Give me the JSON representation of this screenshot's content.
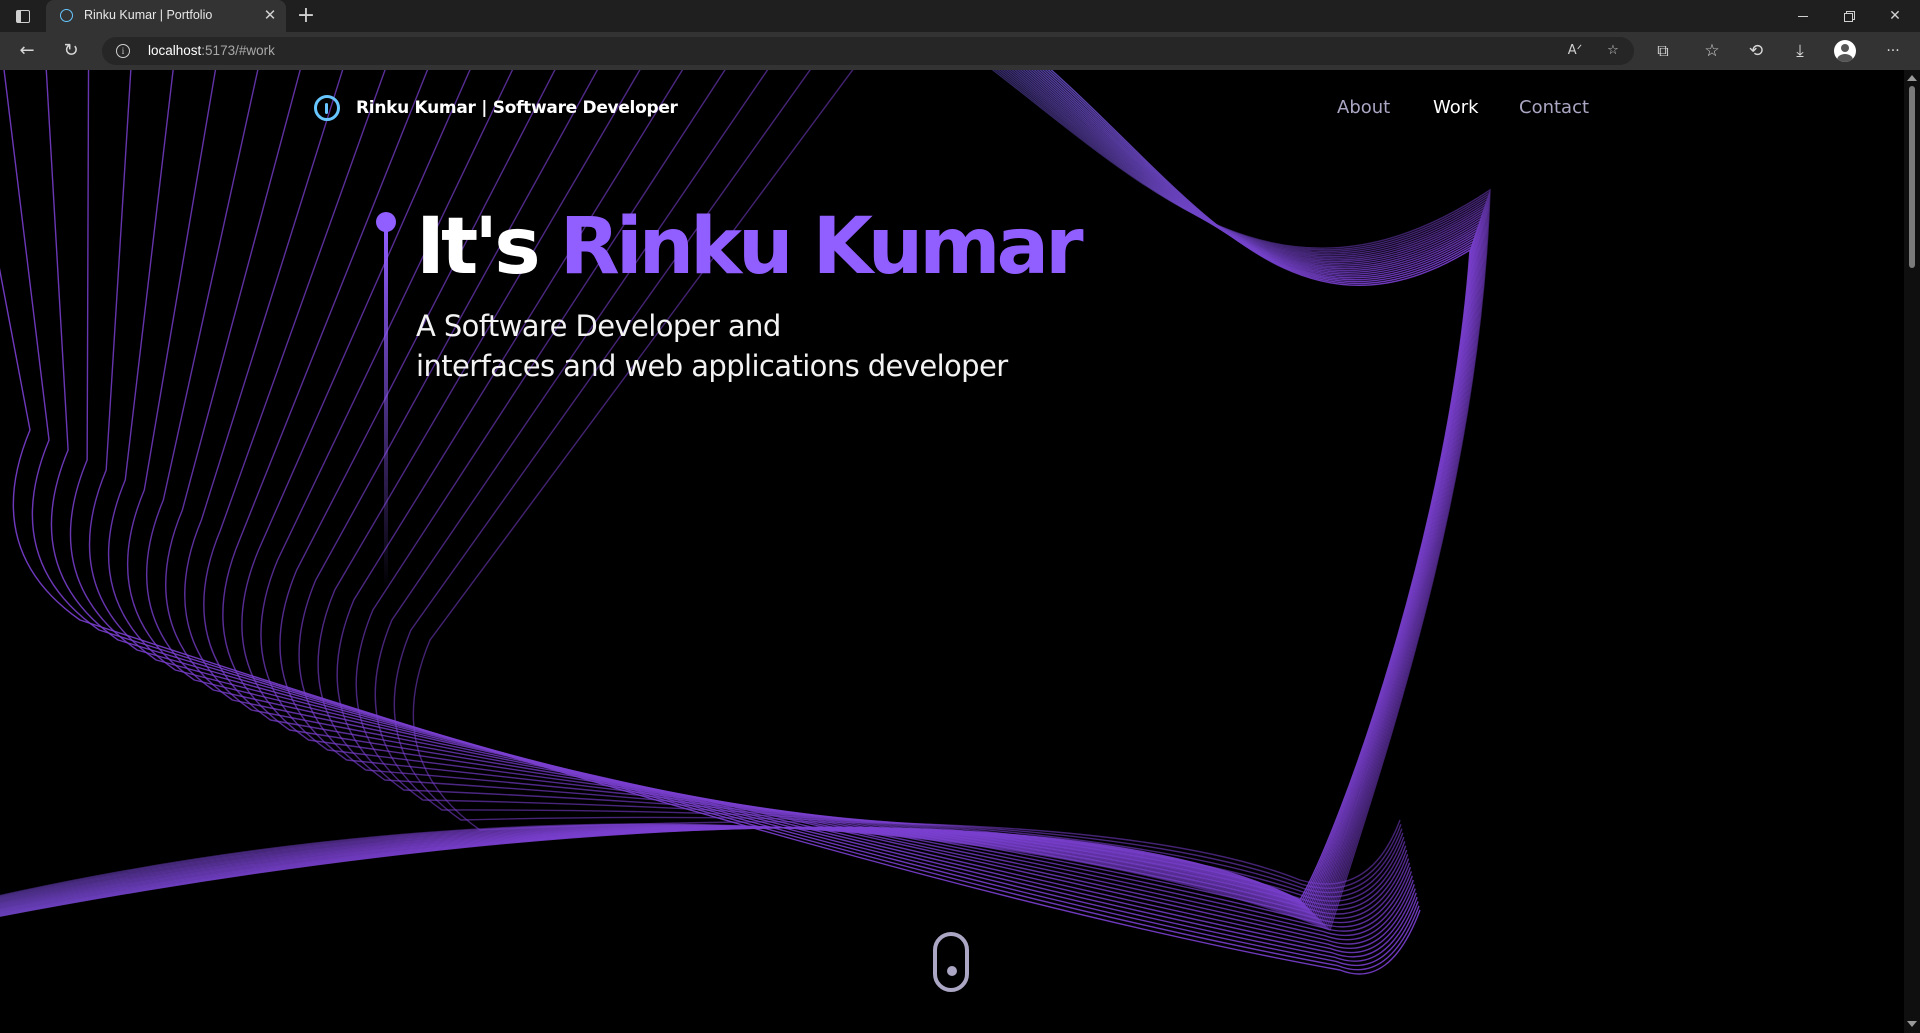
{
  "browser": {
    "tab": {
      "title": "Rinku Kumar | Portfolio",
      "favicon": "info-circle-icon"
    },
    "address": {
      "host": "localhost",
      "path": ":5173/#work"
    },
    "icons": {
      "tab_actions": "tab-actions-icon",
      "new_tab": "+",
      "back": "←",
      "reload": "↻",
      "read_aloud": "Aᐟ",
      "favorite_add": "☆",
      "extensions": "⧉",
      "favorites": "☆",
      "history": "⟲",
      "downloads": "⤓",
      "more": "···",
      "minimize": "minimize-icon",
      "maximize": "restore-icon",
      "close": "✕"
    }
  },
  "site": {
    "brand": {
      "name": "Rinku Kumar",
      "separator": " |",
      "role": "Software Developer"
    },
    "nav": [
      {
        "label": "About"
      },
      {
        "label": "Work"
      },
      {
        "label": "Contact"
      }
    ],
    "active_nav": "Work",
    "hero": {
      "title_prefix": "It's ",
      "title_name": "Rinku Kumar",
      "subtitle_line1": "A Software Developer and",
      "subtitle_line2": "interfaces and web applications developer"
    }
  },
  "colors": {
    "accent": "#915eff",
    "secondary_text": "#aaa6c3",
    "logo": "#67c6ff",
    "background": "#000000",
    "lines_blue": "#3b5b9a",
    "lines_purple": "#7a3fd0"
  }
}
